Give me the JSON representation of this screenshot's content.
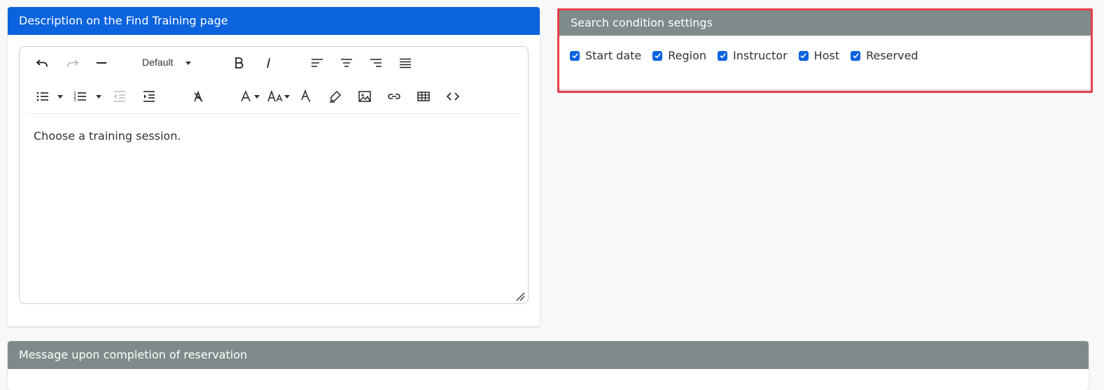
{
  "description_panel": {
    "title": "Description on the Find Training page",
    "editor": {
      "format_select": "Default",
      "content": "Choose a training session."
    }
  },
  "search_panel": {
    "title": "Search condition settings",
    "checkboxes": [
      {
        "label": "Start date",
        "checked": true
      },
      {
        "label": "Region",
        "checked": true
      },
      {
        "label": "Instructor",
        "checked": true
      },
      {
        "label": "Host",
        "checked": true
      },
      {
        "label": "Reserved",
        "checked": true
      }
    ]
  },
  "message_panel": {
    "title": "Message upon completion of reservation"
  },
  "colors": {
    "primary_header": "#0b63de",
    "secondary_header": "#7f8b8b",
    "highlight_border": "#e8404a",
    "checkbox": "#0b63de"
  }
}
